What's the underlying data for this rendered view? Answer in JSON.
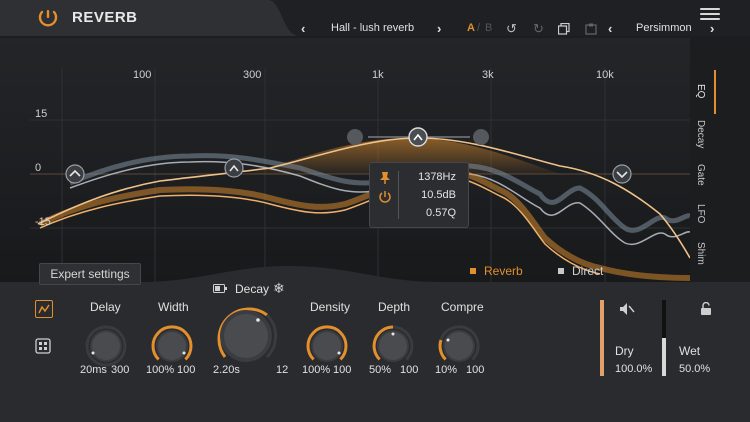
{
  "header": {
    "title": "REVERB",
    "preset_name": "Hall - lush reverb",
    "ab_a": "A",
    "ab_sep": "/",
    "ab_b": "B",
    "preset_bank": "Persimmon"
  },
  "graph": {
    "freq_labels": [
      "100",
      "300",
      "1k",
      "3k",
      "10k"
    ],
    "db_labels": [
      "15",
      "0",
      "-15"
    ],
    "tabs": [
      "EQ",
      "Decay",
      "Gate",
      "LFO",
      "Shim"
    ],
    "tooltip": {
      "freq": "1378Hz",
      "gain": "10.5dB",
      "q": "0.57Q"
    },
    "legend": {
      "reverb": "Reverb",
      "direct": "Direct",
      "reverb_color": "#e28f2d",
      "direct_color": "#c8c8c8"
    }
  },
  "expert_label": "Expert settings",
  "params": {
    "delay": {
      "label": "Delay",
      "min": "20ms",
      "max": "300"
    },
    "width": {
      "label": "Width",
      "min": "100%",
      "max": "100"
    },
    "decay": {
      "label": "Decay",
      "min": "2.20s",
      "max": "12"
    },
    "density": {
      "label": "Density",
      "min": "100%",
      "max": "100"
    },
    "depth": {
      "label": "Depth",
      "min": "50%",
      "max": "100"
    },
    "compre": {
      "label": "Compre",
      "min": "10%",
      "max": "100"
    }
  },
  "mix": {
    "dry_label": "Dry",
    "dry_value": "100.0%",
    "wet_label": "Wet",
    "wet_value": "50.0%",
    "dry_level": 1.0,
    "wet_level": 0.5
  },
  "colors": {
    "accent": "#e28f2d"
  }
}
